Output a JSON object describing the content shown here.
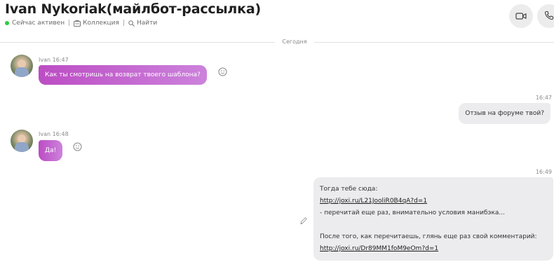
{
  "header": {
    "title": "Ivan Nykoriak(майлбот-рассылка)",
    "status": "Сейчас активен",
    "collection_label": "Коллекция",
    "find_label": "Найти",
    "status_color": "#2ecc40"
  },
  "conversation": {
    "day_label": "Сегодня",
    "messages": [
      {
        "direction": "in",
        "meta": "Ivan 16:47",
        "text": "Как ты смотришь на возврат твоего шаблона?"
      },
      {
        "direction": "out",
        "time": "16:47",
        "text": "Отзыв на форуме твой?"
      },
      {
        "direction": "in",
        "meta": "Ivan 16:48",
        "text": "Да!"
      },
      {
        "direction": "out",
        "time": "16:49",
        "lines": [
          "Тогда тебе сюда:",
          "http://joxi.ru/L21JooliR0B4qA?d=1",
          "- перечитай еще раз, внимательно условия манибэка...",
          "",
          "После того, как перечитаешь, глянь еще раз свой комментарий:",
          "http://joxi.ru/Dr89MM1foM9eOm?d=1"
        ]
      }
    ]
  },
  "colors": {
    "incoming_bubble_start": "#bc4dc4",
    "incoming_bubble_end": "#cc82dc",
    "outgoing_bubble": "#ececee"
  }
}
